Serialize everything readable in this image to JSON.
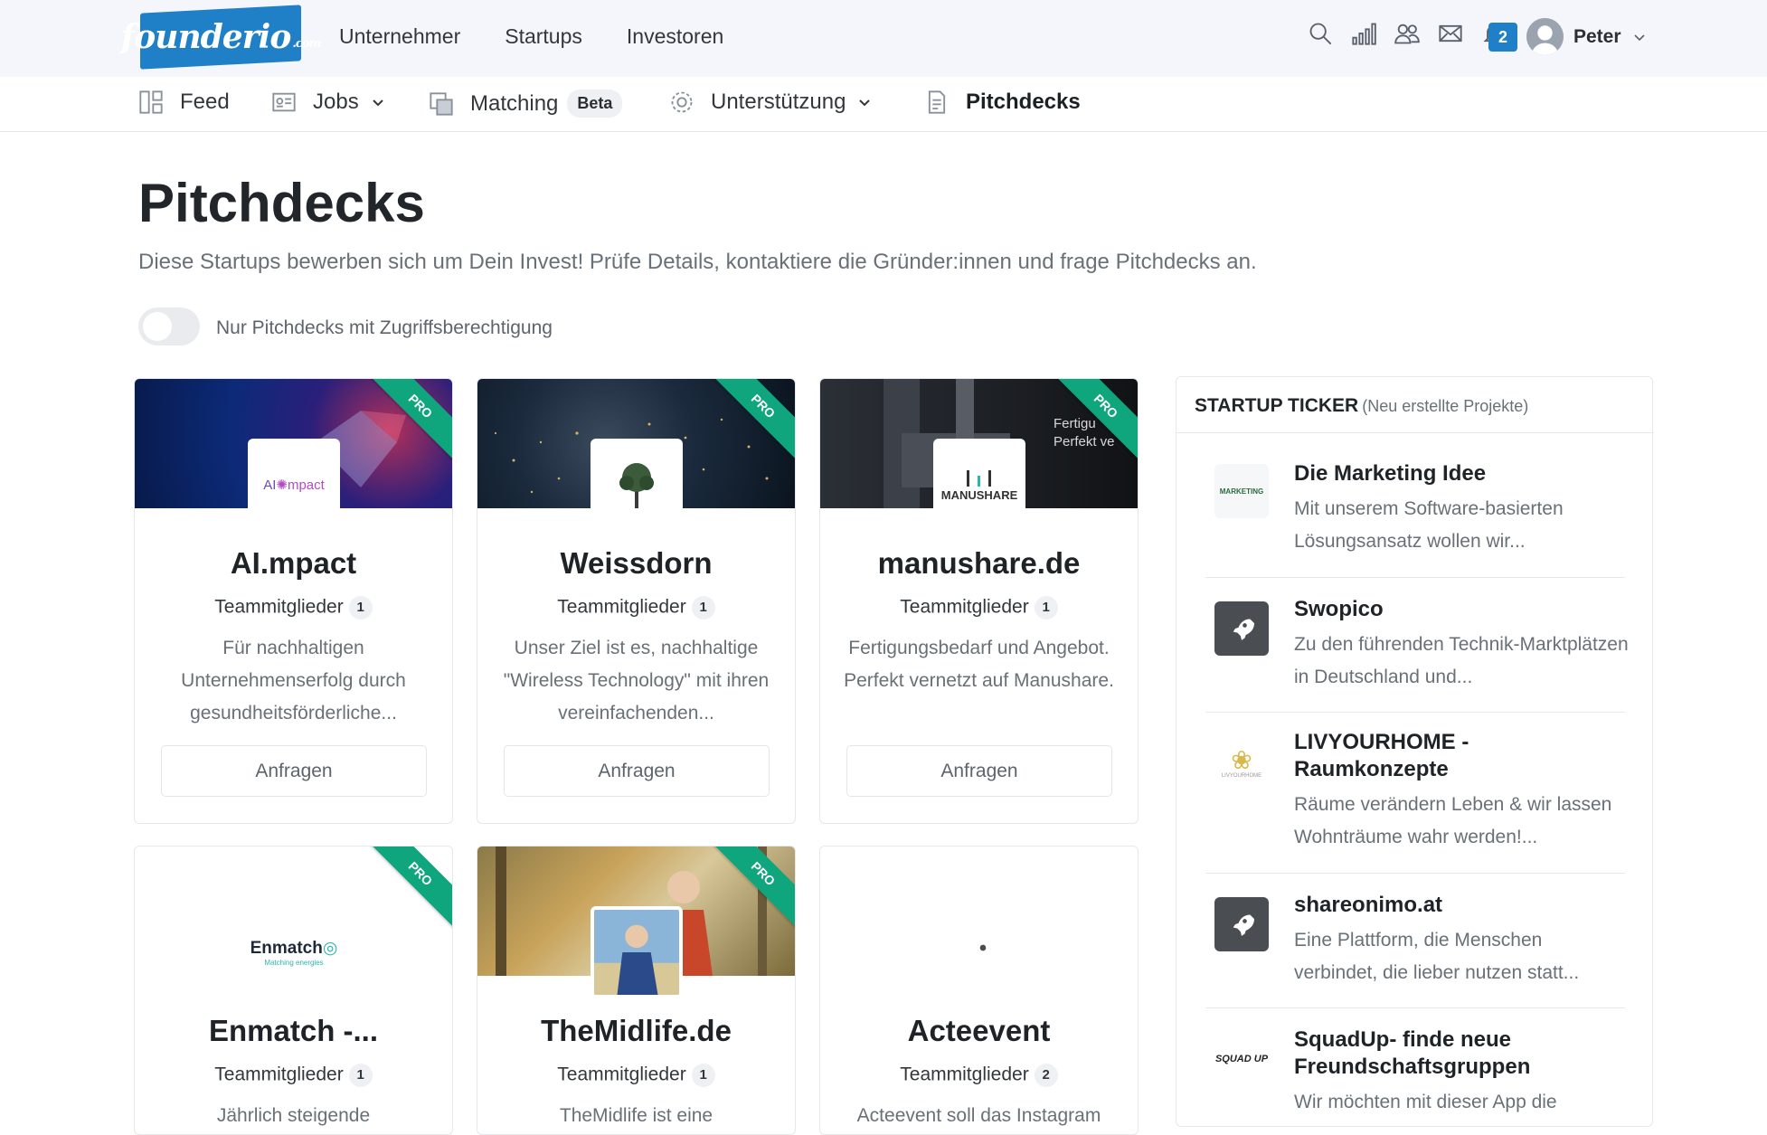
{
  "brand": {
    "logo_text": "founderio",
    "logo_suffix": ".com"
  },
  "top_nav": [
    "Unternehmer",
    "Startups",
    "Investoren"
  ],
  "user": {
    "name": "Peter",
    "notifications": "2"
  },
  "icons": [
    "search-icon",
    "chart-icon",
    "users-icon",
    "mail-icon",
    "bell-icon",
    "chevron-down-icon"
  ],
  "sub_nav": {
    "feed": "Feed",
    "jobs": "Jobs",
    "matching": "Matching",
    "beta": "Beta",
    "support": "Unterstützung",
    "pitchdecks": "Pitchdecks"
  },
  "page": {
    "title": "Pitchdecks",
    "subtitle": "Diese Startups bewerben sich um Dein Invest! Prüfe Details, kontaktiere die Gründer:innen und frage Pitchdecks an.",
    "toggle_label": "Nur Pitchdecks mit Zugriffsberechtigung"
  },
  "cards": [
    {
      "name": "AI.mpact",
      "team_label": "Teammitglieder",
      "team_count": "1",
      "pro": "PRO",
      "logo_text": "AI",
      "logo_text2": "mpact",
      "desc": "Für nachhaltigen Unternehmenserfolg durch gesundheitsförderliche...",
      "button": "Anfragen"
    },
    {
      "name": "Weissdorn",
      "team_label": "Teammitglieder",
      "team_count": "1",
      "pro": "PRO",
      "desc": "Unser Ziel ist es, nachhaltige \"Wireless Technology\" mit ihren vereinfachenden...",
      "button": "Anfragen"
    },
    {
      "name": "manushare.de",
      "team_label": "Teammitglieder",
      "team_count": "1",
      "pro": "PRO",
      "logo_text": "MANUSHARE",
      "banner_text1": "Fertigu",
      "banner_text2": "Perfekt ve",
      "desc": "Fertigungsbedarf und Angebot. Perfekt vernetzt auf Manushare.",
      "button": "Anfragen"
    },
    {
      "name": "Enmatch -...",
      "team_label": "Teammitglieder",
      "team_count": "1",
      "pro": "PRO",
      "logo_text": "Enmatch",
      "logo_sub": "Matching energies",
      "desc": "Jährlich steigende"
    },
    {
      "name": "TheMidlife.de",
      "team_label": "Teammitglieder",
      "team_count": "1",
      "pro": "PRO",
      "desc": "TheMidlife ist eine"
    },
    {
      "name": "Acteevent",
      "team_label": "Teammitglieder",
      "team_count": "2",
      "desc": "Acteevent soll das Instagram"
    }
  ],
  "ticker": {
    "title": "STARTUP TICKER",
    "subtitle": "(Neu erstellte Projekte)",
    "items": [
      {
        "name": "Die Marketing Idee",
        "desc": "Mit unserem Software-basierten Lösungsansatz wollen wir...",
        "logo_text": "MARKETING"
      },
      {
        "name": "Swopico",
        "desc": "Zu den führenden Technik-Marktplätzen in Deutschland und..."
      },
      {
        "name": "LIVYOURHOME - Raumkonzepte",
        "desc": "Räume verändern Leben & wir lassen Wohnträume wahr werden!...",
        "logo_text": "LIVYOURHOME"
      },
      {
        "name": "shareonimo.at",
        "desc": "Eine Plattform, die Menschen verbindet, die lieber nutzen statt..."
      },
      {
        "name": "SquadUp- finde neue Freundschaftsgruppen",
        "desc": "Wir möchten mit dieser App die",
        "logo_text": "SQUAD UP"
      }
    ]
  }
}
